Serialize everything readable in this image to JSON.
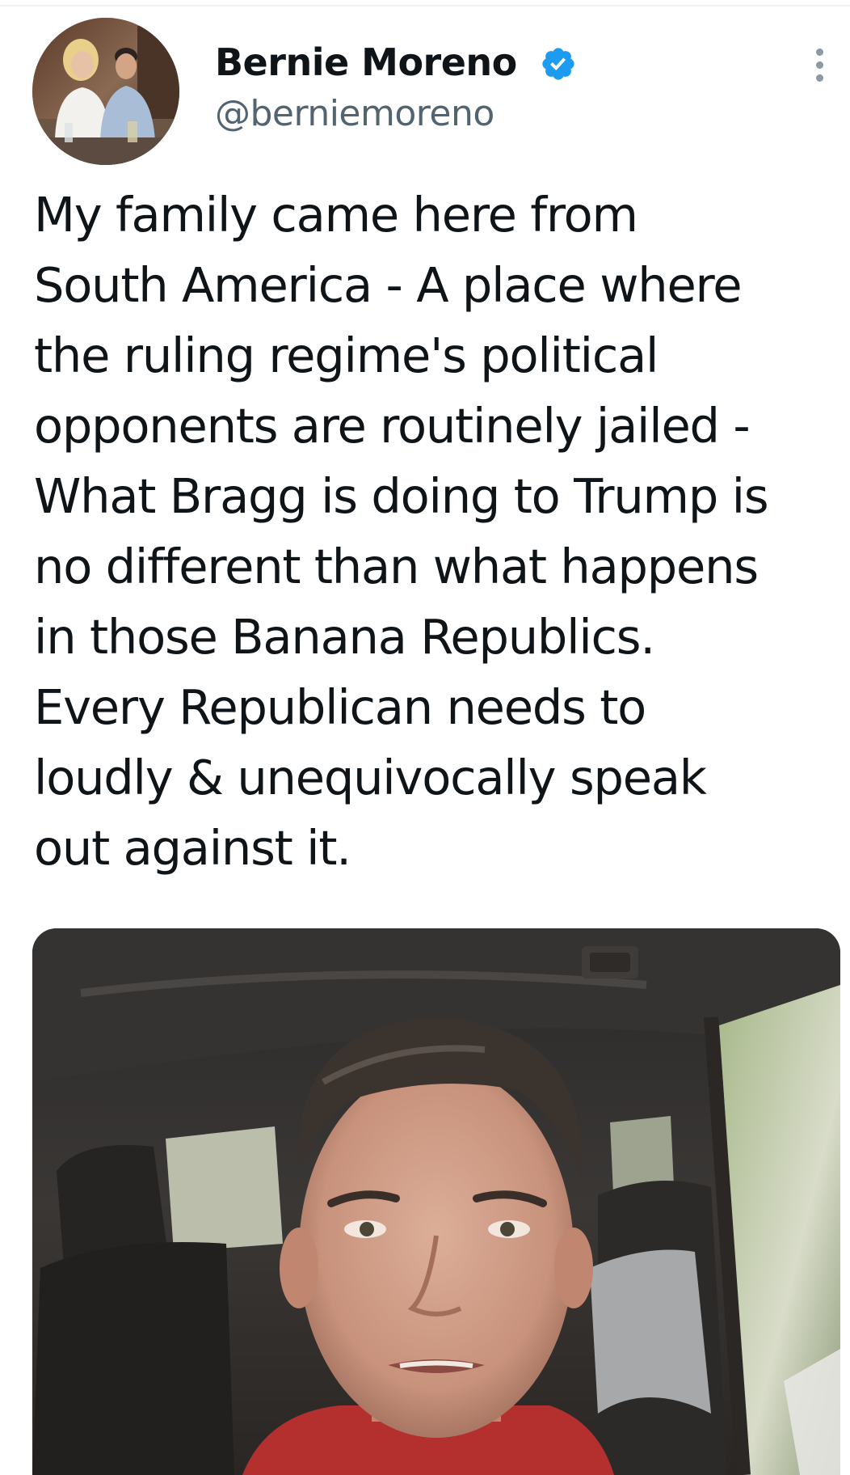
{
  "tweet": {
    "author": {
      "display_name": "Bernie Moreno",
      "handle": "@berniemoreno",
      "verified": true,
      "avatar_icon": "profile-photo"
    },
    "more_icon": "vertical-ellipsis-icon",
    "text_lines": [
      "My family came here from",
      "South America - A place where",
      "the ruling regime's political",
      "opponents are routinely jailed -",
      "What Bragg is doing to Trump is",
      "no different than what happens",
      "in those Banana Republics.",
      "Every Republican needs to",
      "loudly & unequivocally speak",
      "out against it."
    ],
    "media": {
      "type": "video-thumbnail",
      "description_icon": "video-still-man-in-car"
    }
  },
  "colors": {
    "text": "#0f1419",
    "secondary_text": "#536471",
    "verified_badge": "#1d9bf0",
    "divider": "#eef0f2"
  }
}
